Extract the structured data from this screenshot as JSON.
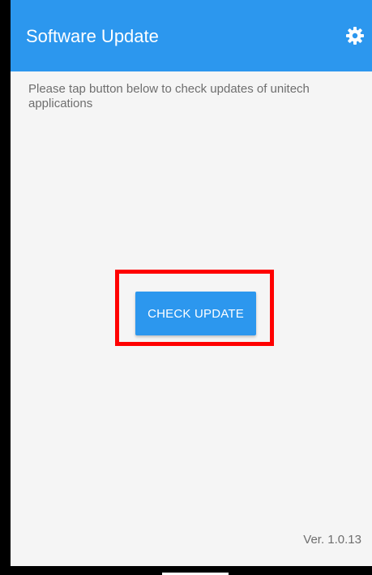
{
  "app_bar": {
    "title": "Software Update",
    "settings_icon": "gear-icon",
    "color": "#2C97EE"
  },
  "content": {
    "instruction": "Please tap button below to check updates of unitech applications",
    "check_update_label": "CHECK UPDATE",
    "version": "Ver. 1.0.13"
  },
  "annotation": {
    "highlight_color": "#FF0000"
  }
}
